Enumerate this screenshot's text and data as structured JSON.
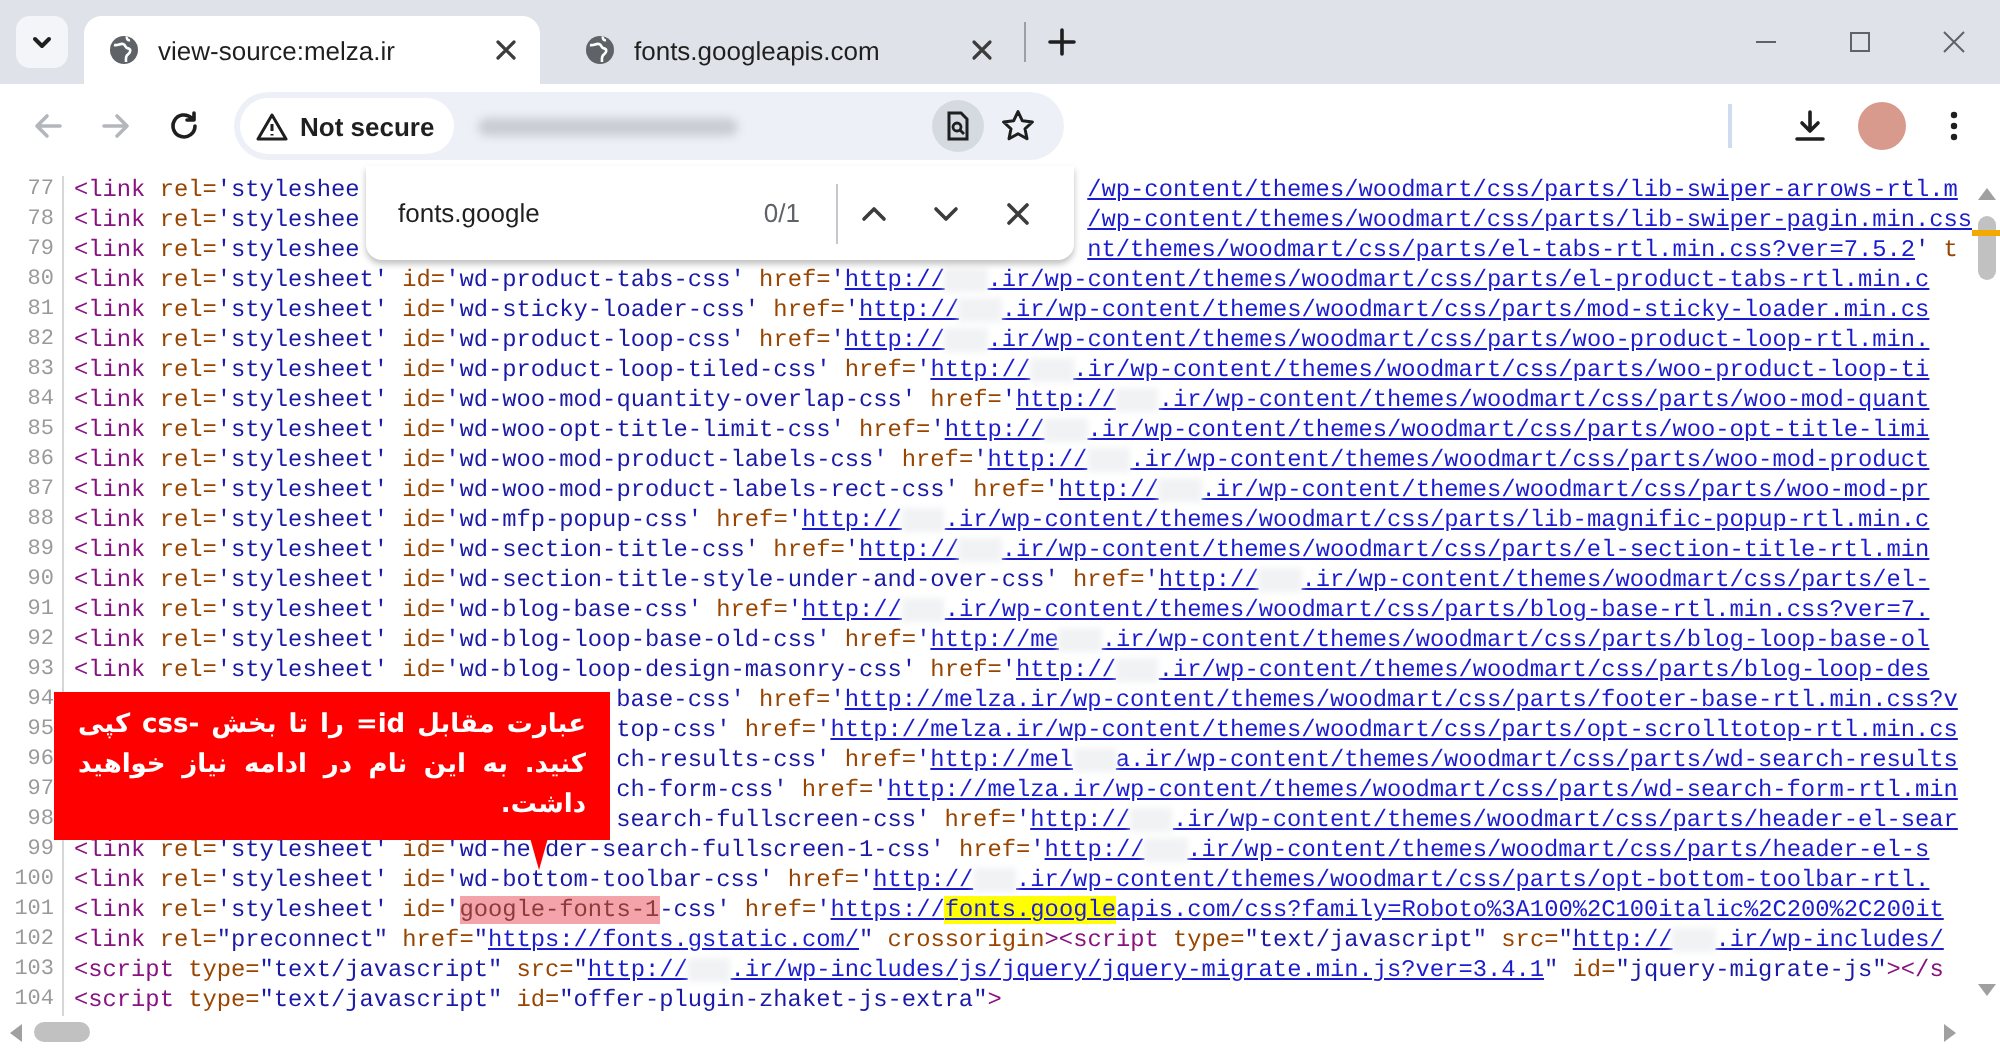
{
  "tabs": [
    {
      "title": "view-source:melza.ir",
      "selected": true
    },
    {
      "title": "fonts.googleapis.com",
      "selected": false
    }
  ],
  "navigation": {
    "back_disabled": true,
    "forward_disabled": true,
    "security_chip": "Not secure"
  },
  "find_bar": {
    "query": "fonts.google",
    "count": "0/1"
  },
  "source": {
    "lines": [
      {
        "number": "77",
        "segments": [
          {
            "kind": "tag",
            "text": "<link"
          },
          {
            "kind": "attr",
            "text": " rel="
          },
          {
            "kind": "value",
            "text": "'styleshee"
          },
          {
            "kind": "hidden-by-find-bar"
          },
          {
            "kind": "link",
            "text": "/wp-content/themes/woodmart/css/parts/lib-swiper-arrows-rtl.m"
          }
        ]
      },
      {
        "number": "78",
        "segments": [
          {
            "kind": "tag",
            "text": "<link"
          },
          {
            "kind": "attr",
            "text": " rel="
          },
          {
            "kind": "value",
            "text": "'styleshee"
          },
          {
            "kind": "hidden-by-find-bar"
          },
          {
            "kind": "link",
            "text": "/wp-content/themes/woodmart/css/parts/lib-swiper-pagin.min.css"
          }
        ]
      },
      {
        "number": "79",
        "segments": [
          {
            "kind": "tag",
            "text": "<link"
          },
          {
            "kind": "attr",
            "text": " rel="
          },
          {
            "kind": "value",
            "text": "'styleshee"
          },
          {
            "kind": "hidden-by-find-bar"
          },
          {
            "kind": "link",
            "text": "nt/themes/woodmart/css/parts/el-tabs-rtl.min.css?ver=7.5.2"
          },
          {
            "kind": "value",
            "text": "'"
          },
          {
            "kind": "attr",
            "text": " t"
          }
        ]
      },
      {
        "number": "80",
        "segments": [
          {
            "kind": "tag",
            "text": "<link"
          },
          {
            "kind": "attr",
            "text": " rel="
          },
          {
            "kind": "value",
            "text": "'stylesheet'"
          },
          {
            "kind": "attr",
            "text": " id="
          },
          {
            "kind": "value",
            "text": "'wd-product-tabs-css'"
          },
          {
            "kind": "attr",
            "text": " href="
          },
          {
            "kind": "value",
            "text": "'"
          },
          {
            "kind": "link",
            "text": "http://"
          },
          {
            "kind": "blur"
          },
          {
            "kind": "link",
            "text": ".ir/wp-content/themes/woodmart/css/parts/el-product-tabs-rtl.min.c"
          }
        ]
      },
      {
        "number": "81",
        "segments": [
          {
            "kind": "tag",
            "text": "<link"
          },
          {
            "kind": "attr",
            "text": " rel="
          },
          {
            "kind": "value",
            "text": "'stylesheet'"
          },
          {
            "kind": "attr",
            "text": " id="
          },
          {
            "kind": "value",
            "text": "'wd-sticky-loader-css'"
          },
          {
            "kind": "attr",
            "text": " href="
          },
          {
            "kind": "value",
            "text": "'"
          },
          {
            "kind": "link",
            "text": "http://"
          },
          {
            "kind": "blur"
          },
          {
            "kind": "link",
            "text": ".ir/wp-content/themes/woodmart/css/parts/mod-sticky-loader.min.cs"
          }
        ]
      },
      {
        "number": "82",
        "segments": [
          {
            "kind": "tag",
            "text": "<link"
          },
          {
            "kind": "attr",
            "text": " rel="
          },
          {
            "kind": "value",
            "text": "'stylesheet'"
          },
          {
            "kind": "attr",
            "text": " id="
          },
          {
            "kind": "value",
            "text": "'wd-product-loop-css'"
          },
          {
            "kind": "attr",
            "text": " href="
          },
          {
            "kind": "value",
            "text": "'"
          },
          {
            "kind": "link",
            "text": "http://"
          },
          {
            "kind": "blur"
          },
          {
            "kind": "link",
            "text": ".ir/wp-content/themes/woodmart/css/parts/woo-product-loop-rtl.min."
          }
        ]
      },
      {
        "number": "83",
        "segments": [
          {
            "kind": "tag",
            "text": "<link"
          },
          {
            "kind": "attr",
            "text": " rel="
          },
          {
            "kind": "value",
            "text": "'stylesheet'"
          },
          {
            "kind": "attr",
            "text": " id="
          },
          {
            "kind": "value",
            "text": "'wd-product-loop-tiled-css'"
          },
          {
            "kind": "attr",
            "text": " href="
          },
          {
            "kind": "value",
            "text": "'"
          },
          {
            "kind": "link",
            "text": "http://"
          },
          {
            "kind": "blur"
          },
          {
            "kind": "link",
            "text": ".ir/wp-content/themes/woodmart/css/parts/woo-product-loop-ti"
          }
        ]
      },
      {
        "number": "84",
        "segments": [
          {
            "kind": "tag",
            "text": "<link"
          },
          {
            "kind": "attr",
            "text": " rel="
          },
          {
            "kind": "value",
            "text": "'stylesheet'"
          },
          {
            "kind": "attr",
            "text": " id="
          },
          {
            "kind": "value",
            "text": "'wd-woo-mod-quantity-overlap-css'"
          },
          {
            "kind": "attr",
            "text": " href="
          },
          {
            "kind": "value",
            "text": "'"
          },
          {
            "kind": "link",
            "text": "http://"
          },
          {
            "kind": "blur"
          },
          {
            "kind": "link",
            "text": ".ir/wp-content/themes/woodmart/css/parts/woo-mod-quant"
          }
        ]
      },
      {
        "number": "85",
        "segments": [
          {
            "kind": "tag",
            "text": "<link"
          },
          {
            "kind": "attr",
            "text": " rel="
          },
          {
            "kind": "value",
            "text": "'stylesheet'"
          },
          {
            "kind": "attr",
            "text": " id="
          },
          {
            "kind": "value",
            "text": "'wd-woo-opt-title-limit-css'"
          },
          {
            "kind": "attr",
            "text": " href="
          },
          {
            "kind": "value",
            "text": "'"
          },
          {
            "kind": "link",
            "text": "http://"
          },
          {
            "kind": "blur"
          },
          {
            "kind": "link",
            "text": ".ir/wp-content/themes/woodmart/css/parts/woo-opt-title-limi"
          }
        ]
      },
      {
        "number": "86",
        "segments": [
          {
            "kind": "tag",
            "text": "<link"
          },
          {
            "kind": "attr",
            "text": " rel="
          },
          {
            "kind": "value",
            "text": "'stylesheet'"
          },
          {
            "kind": "attr",
            "text": " id="
          },
          {
            "kind": "value",
            "text": "'wd-woo-mod-product-labels-css'"
          },
          {
            "kind": "attr",
            "text": " href="
          },
          {
            "kind": "value",
            "text": "'"
          },
          {
            "kind": "link",
            "text": "http://"
          },
          {
            "kind": "blur"
          },
          {
            "kind": "link",
            "text": ".ir/wp-content/themes/woodmart/css/parts/woo-mod-product"
          }
        ]
      },
      {
        "number": "87",
        "segments": [
          {
            "kind": "tag",
            "text": "<link"
          },
          {
            "kind": "attr",
            "text": " rel="
          },
          {
            "kind": "value",
            "text": "'stylesheet'"
          },
          {
            "kind": "attr",
            "text": " id="
          },
          {
            "kind": "value",
            "text": "'wd-woo-mod-product-labels-rect-css'"
          },
          {
            "kind": "attr",
            "text": " href="
          },
          {
            "kind": "value",
            "text": "'"
          },
          {
            "kind": "link",
            "text": "http://"
          },
          {
            "kind": "blur"
          },
          {
            "kind": "link",
            "text": ".ir/wp-content/themes/woodmart/css/parts/woo-mod-pr"
          }
        ]
      },
      {
        "number": "88",
        "segments": [
          {
            "kind": "tag",
            "text": "<link"
          },
          {
            "kind": "attr",
            "text": " rel="
          },
          {
            "kind": "value",
            "text": "'stylesheet'"
          },
          {
            "kind": "attr",
            "text": " id="
          },
          {
            "kind": "value",
            "text": "'wd-mfp-popup-css'"
          },
          {
            "kind": "attr",
            "text": " href="
          },
          {
            "kind": "value",
            "text": "'"
          },
          {
            "kind": "link",
            "text": "http://"
          },
          {
            "kind": "blur"
          },
          {
            "kind": "link",
            "text": ".ir/wp-content/themes/woodmart/css/parts/lib-magnific-popup-rtl.min.c"
          }
        ]
      },
      {
        "number": "89",
        "segments": [
          {
            "kind": "tag",
            "text": "<link"
          },
          {
            "kind": "attr",
            "text": " rel="
          },
          {
            "kind": "value",
            "text": "'stylesheet'"
          },
          {
            "kind": "attr",
            "text": " id="
          },
          {
            "kind": "value",
            "text": "'wd-section-title-css'"
          },
          {
            "kind": "attr",
            "text": " href="
          },
          {
            "kind": "value",
            "text": "'"
          },
          {
            "kind": "link",
            "text": "http://"
          },
          {
            "kind": "blur"
          },
          {
            "kind": "link",
            "text": ".ir/wp-content/themes/woodmart/css/parts/el-section-title-rtl.min"
          }
        ]
      },
      {
        "number": "90",
        "segments": [
          {
            "kind": "tag",
            "text": "<link"
          },
          {
            "kind": "attr",
            "text": " rel="
          },
          {
            "kind": "value",
            "text": "'stylesheet'"
          },
          {
            "kind": "attr",
            "text": " id="
          },
          {
            "kind": "value",
            "text": "'wd-section-title-style-under-and-over-css'"
          },
          {
            "kind": "attr",
            "text": " href="
          },
          {
            "kind": "value",
            "text": "'"
          },
          {
            "kind": "link",
            "text": "http://"
          },
          {
            "kind": "blur"
          },
          {
            "kind": "link",
            "text": ".ir/wp-content/themes/woodmart/css/parts/el-"
          }
        ]
      },
      {
        "number": "91",
        "segments": [
          {
            "kind": "tag",
            "text": "<link"
          },
          {
            "kind": "attr",
            "text": " rel="
          },
          {
            "kind": "value",
            "text": "'stylesheet'"
          },
          {
            "kind": "attr",
            "text": " id="
          },
          {
            "kind": "value",
            "text": "'wd-blog-base-css'"
          },
          {
            "kind": "attr",
            "text": " href="
          },
          {
            "kind": "value",
            "text": "'"
          },
          {
            "kind": "link",
            "text": "http://"
          },
          {
            "kind": "blur"
          },
          {
            "kind": "link",
            "text": ".ir/wp-content/themes/woodmart/css/parts/blog-base-rtl.min.css?ver=7."
          }
        ]
      },
      {
        "number": "92",
        "segments": [
          {
            "kind": "tag",
            "text": "<link"
          },
          {
            "kind": "attr",
            "text": " rel="
          },
          {
            "kind": "value",
            "text": "'stylesheet'"
          },
          {
            "kind": "attr",
            "text": " id="
          },
          {
            "kind": "value",
            "text": "'wd-blog-loop-base-old-css'"
          },
          {
            "kind": "attr",
            "text": " href="
          },
          {
            "kind": "value",
            "text": "'"
          },
          {
            "kind": "link",
            "text": "http://me"
          },
          {
            "kind": "blur"
          },
          {
            "kind": "link",
            "text": ".ir/wp-content/themes/woodmart/css/parts/blog-loop-base-ol"
          }
        ]
      },
      {
        "number": "93",
        "segments": [
          {
            "kind": "tag",
            "text": "<link"
          },
          {
            "kind": "attr",
            "text": " rel="
          },
          {
            "kind": "value",
            "text": "'stylesheet'"
          },
          {
            "kind": "attr",
            "text": " id="
          },
          {
            "kind": "value",
            "text": "'wd-blog-loop-design-masonry-css'"
          },
          {
            "kind": "attr",
            "text": " href="
          },
          {
            "kind": "value",
            "text": "'"
          },
          {
            "kind": "link",
            "text": "http://"
          },
          {
            "kind": "blur"
          },
          {
            "kind": "link",
            "text": ".ir/wp-content/themes/woodmart/css/parts/blog-loop-des"
          }
        ]
      },
      {
        "number": "94",
        "segments": [
          {
            "kind": "hidden-by-note"
          },
          {
            "kind": "value",
            "text": "base-css'"
          },
          {
            "kind": "attr",
            "text": " href="
          },
          {
            "kind": "value",
            "text": "'"
          },
          {
            "kind": "link",
            "text": "http://melza.ir/wp-content/themes/woodmart/css/parts/footer-base-rtl.min.css?v"
          }
        ]
      },
      {
        "number": "95",
        "segments": [
          {
            "kind": "hidden-by-note"
          },
          {
            "kind": "value",
            "text": "top-css'"
          },
          {
            "kind": "attr",
            "text": " href="
          },
          {
            "kind": "value",
            "text": "'"
          },
          {
            "kind": "link",
            "text": "http://melza.ir/wp-content/themes/woodmart/css/parts/opt-scrolltotop-rtl.min.cs"
          }
        ]
      },
      {
        "number": "96",
        "segments": [
          {
            "kind": "hidden-by-note"
          },
          {
            "kind": "value",
            "text": "ch-results-css'"
          },
          {
            "kind": "attr",
            "text": " href="
          },
          {
            "kind": "value",
            "text": "'"
          },
          {
            "kind": "link",
            "text": "http://mel"
          },
          {
            "kind": "blur"
          },
          {
            "kind": "link",
            "text": "a.ir/wp-content/themes/woodmart/css/parts/wd-search-results"
          }
        ]
      },
      {
        "number": "97",
        "segments": [
          {
            "kind": "hidden-by-note"
          },
          {
            "kind": "value",
            "text": "ch-form-css'"
          },
          {
            "kind": "attr",
            "text": " href="
          },
          {
            "kind": "value",
            "text": "'"
          },
          {
            "kind": "link",
            "text": "http://melza.ir/wp-content/themes/woodmart/css/parts/wd-search-form-rtl.min"
          }
        ]
      },
      {
        "number": "98",
        "segments": [
          {
            "kind": "hidden-by-note"
          },
          {
            "kind": "value",
            "text": "search-fullscreen-css'"
          },
          {
            "kind": "attr",
            "text": " href="
          },
          {
            "kind": "value",
            "text": "'"
          },
          {
            "kind": "link",
            "text": "http://"
          },
          {
            "kind": "blur"
          },
          {
            "kind": "link",
            "text": ".ir/wp-content/themes/woodmart/css/parts/header-el-sear"
          }
        ]
      },
      {
        "number": "99",
        "segments": [
          {
            "kind": "tag",
            "text": "<link"
          },
          {
            "kind": "attr",
            "text": " rel="
          },
          {
            "kind": "value",
            "text": "'stylesheet'"
          },
          {
            "kind": "attr",
            "text": " id="
          },
          {
            "kind": "value",
            "text": "'wd-he"
          },
          {
            "kind": "hidden-by-pointer"
          },
          {
            "kind": "value",
            "text": "der-search-fullscreen-1-css'"
          },
          {
            "kind": "attr",
            "text": " href="
          },
          {
            "kind": "value",
            "text": "'"
          },
          {
            "kind": "link",
            "text": "http://"
          },
          {
            "kind": "blur"
          },
          {
            "kind": "link",
            "text": ".ir/wp-content/themes/woodmart/css/parts/header-el-s"
          }
        ]
      },
      {
        "number": "100",
        "segments": [
          {
            "kind": "tag",
            "text": "<link"
          },
          {
            "kind": "attr",
            "text": " rel="
          },
          {
            "kind": "value",
            "text": "'stylesheet'"
          },
          {
            "kind": "attr",
            "text": " id="
          },
          {
            "kind": "value",
            "text": "'wd-bottom-toolbar-css'"
          },
          {
            "kind": "attr",
            "text": " href="
          },
          {
            "kind": "value",
            "text": "'"
          },
          {
            "kind": "link",
            "text": "http://"
          },
          {
            "kind": "blur"
          },
          {
            "kind": "link",
            "text": ".ir/wp-content/themes/woodmart/css/parts/opt-bottom-toolbar-rtl."
          }
        ]
      },
      {
        "number": "101",
        "segments": [
          {
            "kind": "tag",
            "text": "<link"
          },
          {
            "kind": "attr",
            "text": " rel="
          },
          {
            "kind": "value",
            "text": "'stylesheet'"
          },
          {
            "kind": "attr",
            "text": " id="
          },
          {
            "kind": "value",
            "text": "'"
          },
          {
            "kind": "match",
            "text": "google-fonts-1"
          },
          {
            "kind": "value",
            "text": "-css'"
          },
          {
            "kind": "attr",
            "text": " href="
          },
          {
            "kind": "value",
            "text": "'"
          },
          {
            "kind": "link",
            "text": "https://"
          },
          {
            "kind": "find",
            "text": "fonts.google"
          },
          {
            "kind": "link",
            "text": "apis.com/css?family=Roboto%3A100%2C100italic%2C200%2C200it"
          }
        ]
      },
      {
        "number": "102",
        "segments": [
          {
            "kind": "tag",
            "text": "<link"
          },
          {
            "kind": "attr",
            "text": " rel="
          },
          {
            "kind": "value",
            "text": "\"preconnect\""
          },
          {
            "kind": "attr",
            "text": " href="
          },
          {
            "kind": "value",
            "text": "\""
          },
          {
            "kind": "link",
            "text": "https://fonts.gstatic.com/"
          },
          {
            "kind": "value",
            "text": "\""
          },
          {
            "kind": "attr",
            "text": " crossorigin"
          },
          {
            "kind": "tag",
            "text": "><script"
          },
          {
            "kind": "attr",
            "text": " type="
          },
          {
            "kind": "value",
            "text": "\"text/javascript\""
          },
          {
            "kind": "attr",
            "text": " src="
          },
          {
            "kind": "value",
            "text": "\""
          },
          {
            "kind": "link",
            "text": "http://"
          },
          {
            "kind": "blur"
          },
          {
            "kind": "link",
            "text": ".ir/wp-includes/"
          }
        ]
      },
      {
        "number": "103",
        "segments": [
          {
            "kind": "tag",
            "text": "<script"
          },
          {
            "kind": "attr",
            "text": " type="
          },
          {
            "kind": "value",
            "text": "\"text/javascript\""
          },
          {
            "kind": "attr",
            "text": " src="
          },
          {
            "kind": "value",
            "text": "\""
          },
          {
            "kind": "link",
            "text": "http://"
          },
          {
            "kind": "blur"
          },
          {
            "kind": "link",
            "text": ".ir/wp-includes/js/jquery/jquery-migrate.min.js?ver=3.4.1"
          },
          {
            "kind": "value",
            "text": "\""
          },
          {
            "kind": "attr",
            "text": " id="
          },
          {
            "kind": "value",
            "text": "\"jquery-migrate-js\""
          },
          {
            "kind": "tag",
            "text": "></s"
          }
        ]
      },
      {
        "number": "104",
        "segments": [
          {
            "kind": "tag",
            "text": "<script"
          },
          {
            "kind": "attr",
            "text": " type="
          },
          {
            "kind": "value",
            "text": "\"text/javascript\""
          },
          {
            "kind": "attr",
            "text": " id="
          },
          {
            "kind": "value",
            "text": "\"offer-plugin-zhaket-js-extra\""
          },
          {
            "kind": "tag",
            "text": ">"
          }
        ]
      }
    ]
  },
  "annotation": {
    "text": "عبارت مقابل id= را تا بخش -css کپی کنید. به این نام در ادامه نیاز خواهید داشت."
  }
}
